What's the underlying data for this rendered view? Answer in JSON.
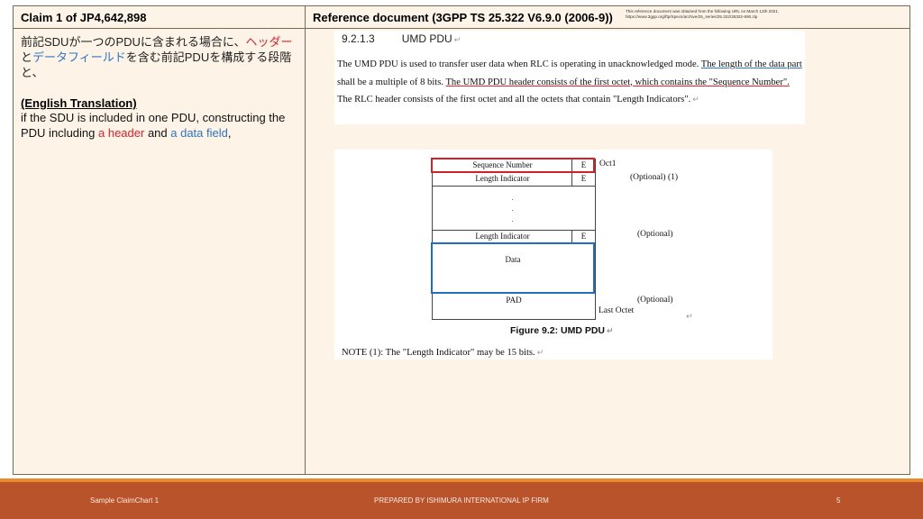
{
  "header": {
    "left_title": "Claim 1 of JP4,642,898",
    "right_title": "Reference document  (3GPP TS 25.322 V6.9.0 (2006-9))",
    "source_note_line1": "This reference document  was obtained  from the following URL on March 12th 2021.",
    "source_note_line2": "https://www.3gpp.org/ftp/Specs/archive/25_series/25.322/25322-690.zip"
  },
  "claim": {
    "jp_part1": "前記SDUが一つのPDUに含まれる場合に、",
    "jp_header": "ヘッダー",
    "jp_and": "と",
    "jp_datafield": "データフィールド",
    "jp_part2": "を含む前記PDUを構成する段階と、",
    "translation_heading": "(English Translation)",
    "en_part1": "if the SDU is included in one PDU, constructing the PDU including ",
    "en_header": "a header",
    "en_and": " and ",
    "en_datafield": "a data field",
    "en_end": ","
  },
  "reference": {
    "section_number": "9.2.1.3",
    "section_title": "UMD PDU",
    "para_intro": "The UMD PDU is used to transfer user data when RLC is operating in unacknowledged mode. ",
    "para_data_part": "The length of the data part",
    "para_mid": " shall be a multiple of 8 bits. ",
    "para_header_part": "The UMD PDU header consists of the first octet, which contains the \"Sequence Number\".",
    "para_end": " The RLC header consists of the first octet and all the octets that contain \"Length Indicators\".",
    "return_mark": "↵",
    "figure": {
      "seq_number": "Sequence Number",
      "e_label": "E",
      "length_indicator": "Length Indicator",
      "data": "Data",
      "pad": "PAD",
      "oct1": "Oct1",
      "optional_1": "(Optional) (1)",
      "optional": "(Optional)",
      "last_octet": "Last Octet",
      "dot": "·",
      "caption": "Figure 9.2: UMD PDU"
    },
    "note": "NOTE (1):  The \"Length Indicator\" may be 15 bits."
  },
  "footer": {
    "left": "Sample ClaimChart 1",
    "center": "PREPARED BY ISHIMURA INTERNATIONAL IP FIRM",
    "page": "5"
  },
  "colors": {
    "header_highlight": "#e8202a",
    "datafield_highlight": "#2e74c6",
    "footer_bg": "#b8532c",
    "footer_stripe": "#e98b2d",
    "cell_bg": "#fdf4e7"
  }
}
